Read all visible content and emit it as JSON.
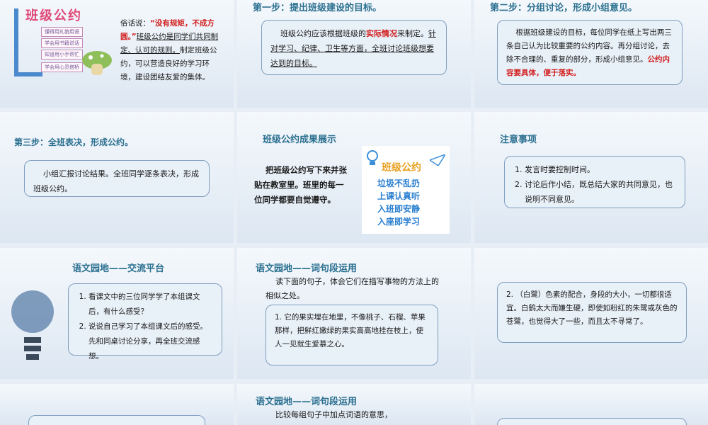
{
  "s1": {
    "poster_title": "班级公约",
    "poster_lines": [
      "懂得用礼貌用语",
      "学会用书籍说话",
      "知道用小手帮忙",
      "学会用心灵搭桥"
    ],
    "t_a": "俗话说：",
    "t_b": "“没有规矩，不成方圆。”",
    "t_c": "班级公约是同学们共同制定、认可的规则。",
    "t_d": "制定班级公约，可以营造良好的学习环境，建设团结友爱的集体。"
  },
  "s2": {
    "heading": "第一步：提出班级建设的目标。",
    "p_a": "班级公约应该根据班级的",
    "p_red": "实际情况",
    "p_b": "来制定。",
    "p_c": "针对学习、纪律、卫生等方面，全班讨论班级想要达到的目标。"
  },
  "s3": {
    "heading": "第二步：分组讨论，形成小组意见。",
    "p_a": "根据班级建设的目标，每位同学在纸上写出两三条自己认为比较重要的公约内容。再分组讨论，去除不合理的、重复的部分，形成小组意见。",
    "p_red": "公约内容要具体，便于落实。"
  },
  "s4": {
    "heading": "第三步：全班表决，形成公约。",
    "p": "小组汇报讨论结果。全班同学逐条表决，形成班级公约。"
  },
  "s5": {
    "heading": "班级公约成果展示",
    "p": "把班级公约写下来并张贴在教室里。班里的每一位同学都要自觉遵守。",
    "card_title": "班级公约",
    "card_lines": [
      "垃圾不乱扔",
      "上课认真听",
      "入班即安静",
      "入座即学习"
    ]
  },
  "s6": {
    "heading": "注意事项",
    "items": [
      "发言时要控制时间。",
      "讨论后作小结，既总结大家的共同意见，也说明不同意见。"
    ]
  },
  "s7": {
    "heading": "语文园地——交流平台",
    "items": [
      "看课文中的三位同学学了本组课文后，有什么感受？",
      "说说自己学习了本组课文后的感受。先和同桌讨论分享，再全班交流感想。"
    ]
  },
  "s8": {
    "heading": "语文园地——词句段运用",
    "intro": "读下面的句子，体会它们在描写事物的方法上的相似之处。",
    "item": "1. 它的果实埋在地里，不像桃子、石榴、苹果那样，把鲜红嫩绿的果实高高地挂在枝上，使人一见就生爱慕之心。"
  },
  "s9": {
    "item": "2. （白鹭）色素的配合，身段的大小，一切都很适宜。白鹤太大而嫌生硬，即使如粉红的朱鹭或灰色的苍鹭，也觉得大了一些，而且太不寻常了。"
  },
  "s11": {
    "heading": "语文园地——词句段运用",
    "intro": "比较每组句子中加点词语的意思，"
  },
  "colors": {
    "heading": "#2a6f8f",
    "red": "#d21f1f",
    "box_border": "#7f9fbf"
  },
  "icons": [
    "bulb-icon",
    "rocket-icon",
    "paper-plane-icon",
    "mushroom-icon"
  ]
}
